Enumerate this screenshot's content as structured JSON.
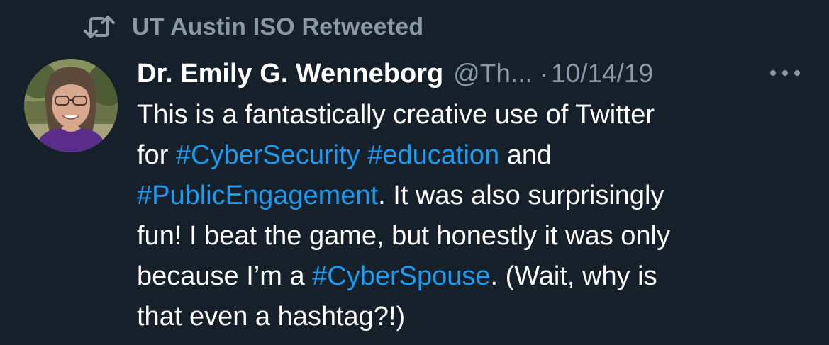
{
  "retweet": {
    "icon": "retweet-icon",
    "label": "UT Austin ISO Retweeted"
  },
  "author": {
    "display_name": "Dr. Emily G. Wenneborg",
    "handle": "@Th...",
    "separator": "·",
    "date": "10/14/19",
    "avatar_icon": "avatar-photo"
  },
  "more_icon": "more-horizontal-icon",
  "colors": {
    "background": "#15202b",
    "muted": "#8b98a5",
    "text": "#ffffff",
    "link": "#1d9bf0"
  },
  "tweet": {
    "line1": "This is a fantastically creative use of Twitter",
    "line2_prefix": "for ",
    "hashtag_cybersecurity": "#CyberSecurity",
    "space1": " ",
    "hashtag_education": "#education",
    "line2_suffix": " and",
    "hashtag_publicengagement": "#PublicEngagement",
    "line3_suffix": ". It was also surprisingly",
    "line4": "fun! I beat the game, but honestly it was only",
    "line5_prefix": "because I’m a ",
    "hashtag_cyberspouse": "#CyberSpouse",
    "line5_suffix": ". (Wait, why is",
    "line6": "that even a hashtag?!)"
  }
}
